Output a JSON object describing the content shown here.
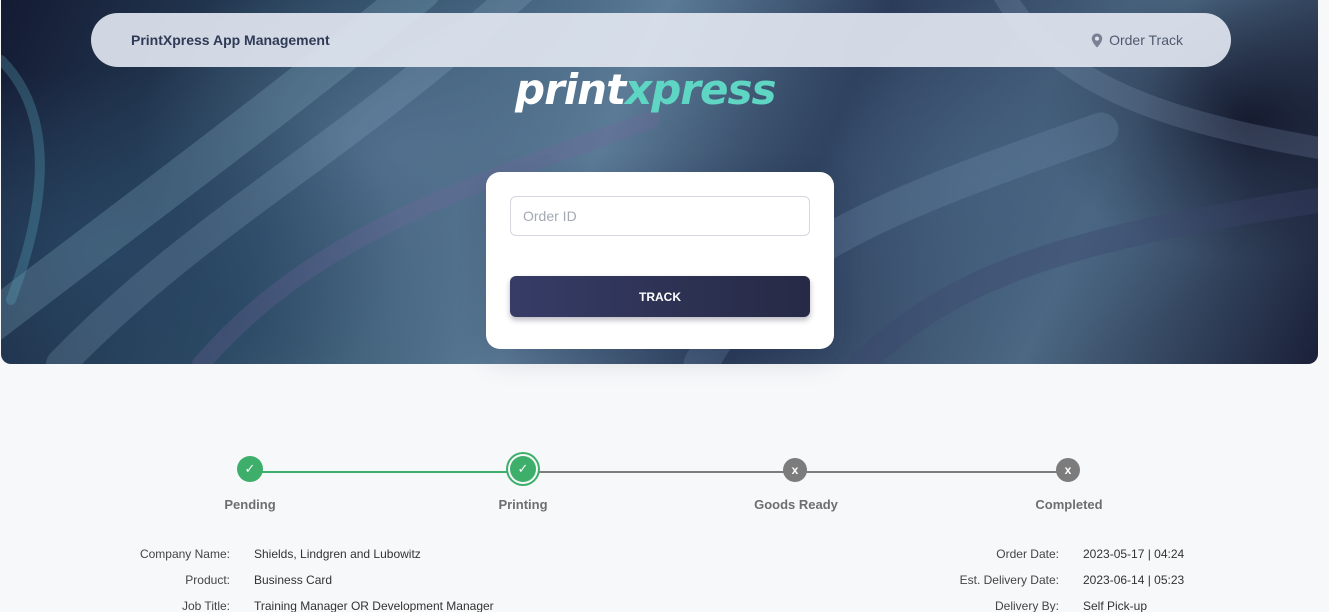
{
  "navbar": {
    "brand": "PrintXpress App Management",
    "link_icon": "map-pin-icon",
    "link_label": "Order Track"
  },
  "logo": {
    "part1": "print",
    "part2": "xpress"
  },
  "track_form": {
    "order_id_placeholder": "Order ID",
    "order_id_value": "",
    "track_button": "TRACK"
  },
  "status": {
    "steps": [
      {
        "label": "Pending",
        "state": "done",
        "glyph": "✓"
      },
      {
        "label": "Printing",
        "state": "current",
        "glyph": "✓"
      },
      {
        "label": "Goods Ready",
        "state": "pending",
        "glyph": "x"
      },
      {
        "label": "Completed",
        "state": "pending",
        "glyph": "x"
      }
    ],
    "colors": {
      "done": "#3daf6a",
      "pending": "#7c7c7c"
    }
  },
  "order_details": {
    "left": [
      {
        "label": "Company Name:",
        "value": "Shields, Lindgren and Lubowitz"
      },
      {
        "label": "Product:",
        "value": "Business Card"
      },
      {
        "label": "Job Title:",
        "value": "Training Manager OR Development Manager"
      }
    ],
    "right": [
      {
        "label": "Order Date:",
        "value": "2023-05-17 | 04:24"
      },
      {
        "label": "Est. Delivery Date:",
        "value": "2023-06-14 | 05:23"
      },
      {
        "label": "Delivery By:",
        "value": "Self Pick-up"
      }
    ]
  }
}
